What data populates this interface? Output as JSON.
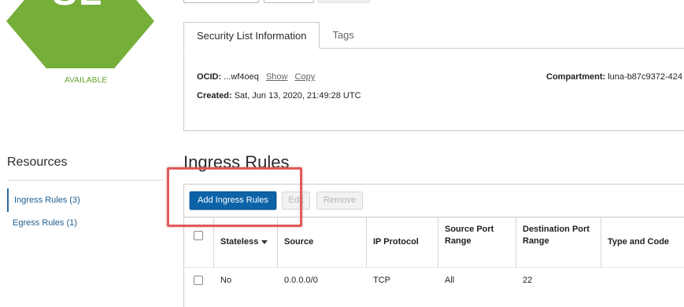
{
  "resource_badge": {
    "letters": "SL",
    "status": "AVAILABLE",
    "color": "#76ae3a"
  },
  "info_tabs": [
    {
      "label": "Security List Information"
    },
    {
      "label": "Tags"
    }
  ],
  "info": {
    "ocid_label": "OCID:",
    "ocid_value": "...wf4oeq",
    "show_link": "Show",
    "copy_link": "Copy",
    "created_label": "Created:",
    "created_value": "Sat, Jun 13, 2020, 21:49:28 UTC",
    "compartment_label": "Compartment:",
    "compartment_value": "luna-b87c9372-424"
  },
  "resources": {
    "title": "Resources",
    "items": [
      {
        "label": "Ingress Rules (3)",
        "active": true
      },
      {
        "label": "Egress Rules (1)",
        "active": false
      }
    ]
  },
  "ingress": {
    "title": "Ingress Rules",
    "buttons": {
      "add": "Add Ingress Rules",
      "edit": "Edit",
      "remove": "Remove"
    },
    "columns": [
      "Stateless",
      "Source",
      "IP Protocol",
      "Source Port\nRange",
      "Destination Port\nRange",
      "Type and Code"
    ],
    "rows": [
      {
        "stateless": "No",
        "source": "0.0.0.0/0",
        "protocol": "TCP",
        "source_port": "All",
        "dest_port": "22",
        "type_code": ""
      }
    ]
  },
  "colors": {
    "primary_button": "#0d63a8",
    "link": "#1f5d8f",
    "highlight": "#e05a5a"
  }
}
